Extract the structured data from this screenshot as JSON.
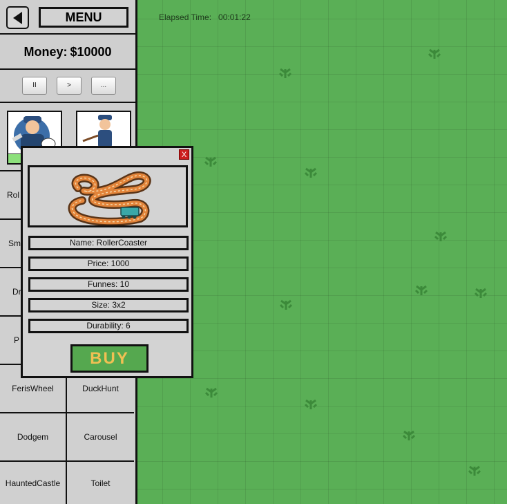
{
  "game": {
    "elapsed_label": "Elapsed Time:",
    "elapsed_value": "00:01:22"
  },
  "sidebar": {
    "menu_label": "MENU",
    "money_label": "Money:",
    "money_value": "$10000",
    "speed_buttons": {
      "pause": "II",
      "play": ">",
      "more": "..."
    },
    "workers": [
      {
        "name": "mechanic-worker"
      },
      {
        "name": "janitor-worker"
      }
    ],
    "attractions": [
      "RollerCoaster",
      "",
      "SmallCoaster",
      "",
      "Drop",
      "",
      "P",
      "",
      "FerisWheel",
      "DuckHunt",
      "Dodgem",
      "Carousel",
      "HauntedCastle",
      "Toilet"
    ],
    "visible_partial": {
      "row1_left": "Rol",
      "row2_left": "Sm",
      "row3_left": "Dr",
      "row4_left": "P"
    }
  },
  "popup": {
    "close_label": "X",
    "name": "Name: RollerCoaster",
    "price": "Price: 1000",
    "funnes": "Funnes: 10",
    "size": "Size: 3x2",
    "durability": "Durability: 6",
    "buy_label": "BUY"
  },
  "colors": {
    "grass": "#5aaf56",
    "panel": "#d0d0d0",
    "buy_bg": "#55a84f",
    "buy_text": "#f0c053",
    "close_bg": "#cc1f1f"
  }
}
